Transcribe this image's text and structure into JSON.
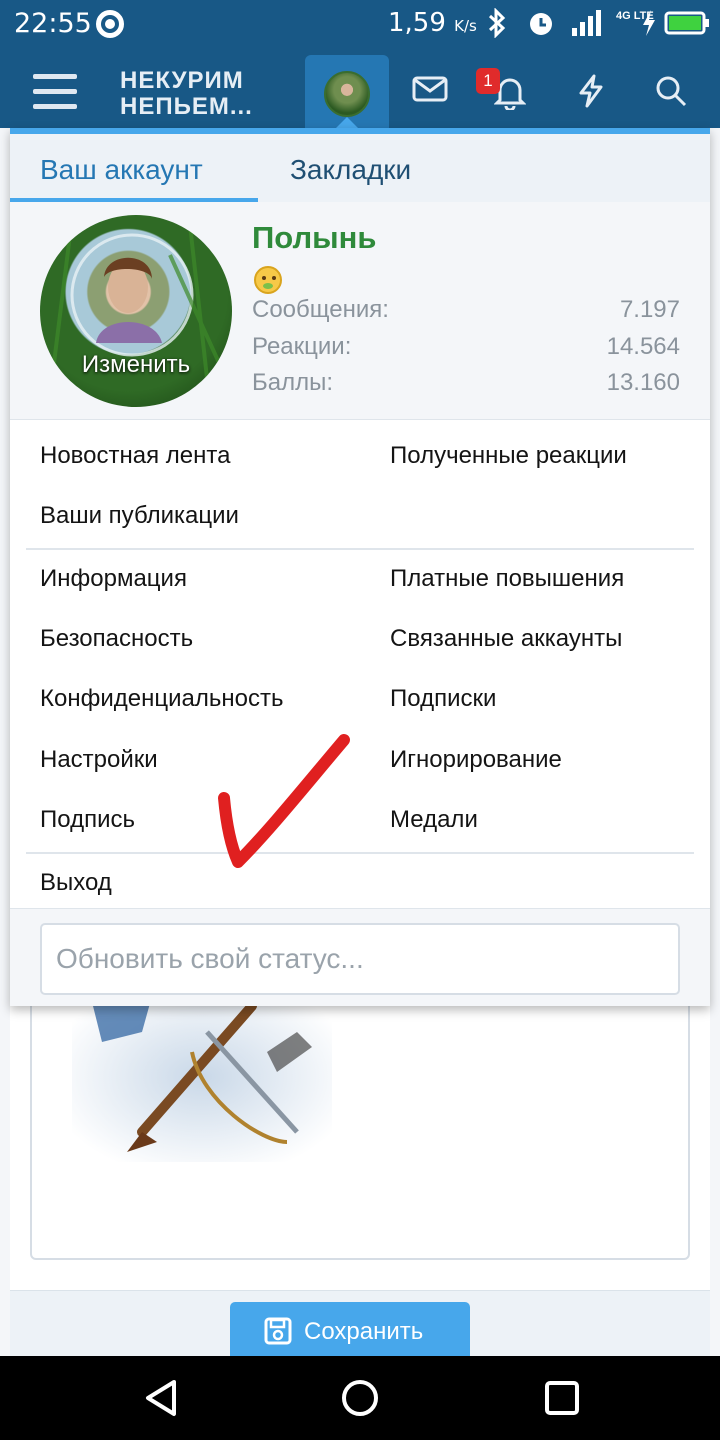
{
  "status_bar": {
    "time": "22:55",
    "speed": "1,59",
    "speed_unit": "K/s",
    "network": "4G LTE"
  },
  "header": {
    "logo_line1": "НЕКУРИМ",
    "logo_line2": "НЕПЬЕМ...",
    "notification_count": "1",
    "accent_color": "#185886"
  },
  "menu": {
    "tabs": [
      {
        "label": "Ваш аккаунт",
        "active": true
      },
      {
        "label": "Закладки",
        "active": false
      }
    ],
    "profile": {
      "avatar_edit_label": "Изменить",
      "username": "Полынь",
      "stats": [
        {
          "label": "Сообщения:",
          "value": "7.197"
        },
        {
          "label": "Реакции:",
          "value": "14.564"
        },
        {
          "label": "Баллы:",
          "value": "13.160"
        }
      ]
    },
    "links": {
      "news_feed": "Новостная лента",
      "received_reactions": "Полученные реакции",
      "your_publications": "Ваши публикации",
      "information": "Информация",
      "paid_upgrades": "Платные повышения",
      "security": "Безопасность",
      "connected_accounts": "Связанные аккаунты",
      "privacy": "Конфиденциальность",
      "following": "Подписки",
      "preferences": "Настройки",
      "ignoring": "Игнорирование",
      "signature": "Подпись",
      "medals": "Медали",
      "logout": "Выход"
    },
    "status_placeholder": "Обновить свой статус..."
  },
  "page": {
    "save_label": "Сохранить"
  },
  "annotation": {
    "checkmark_color": "#e02020"
  }
}
